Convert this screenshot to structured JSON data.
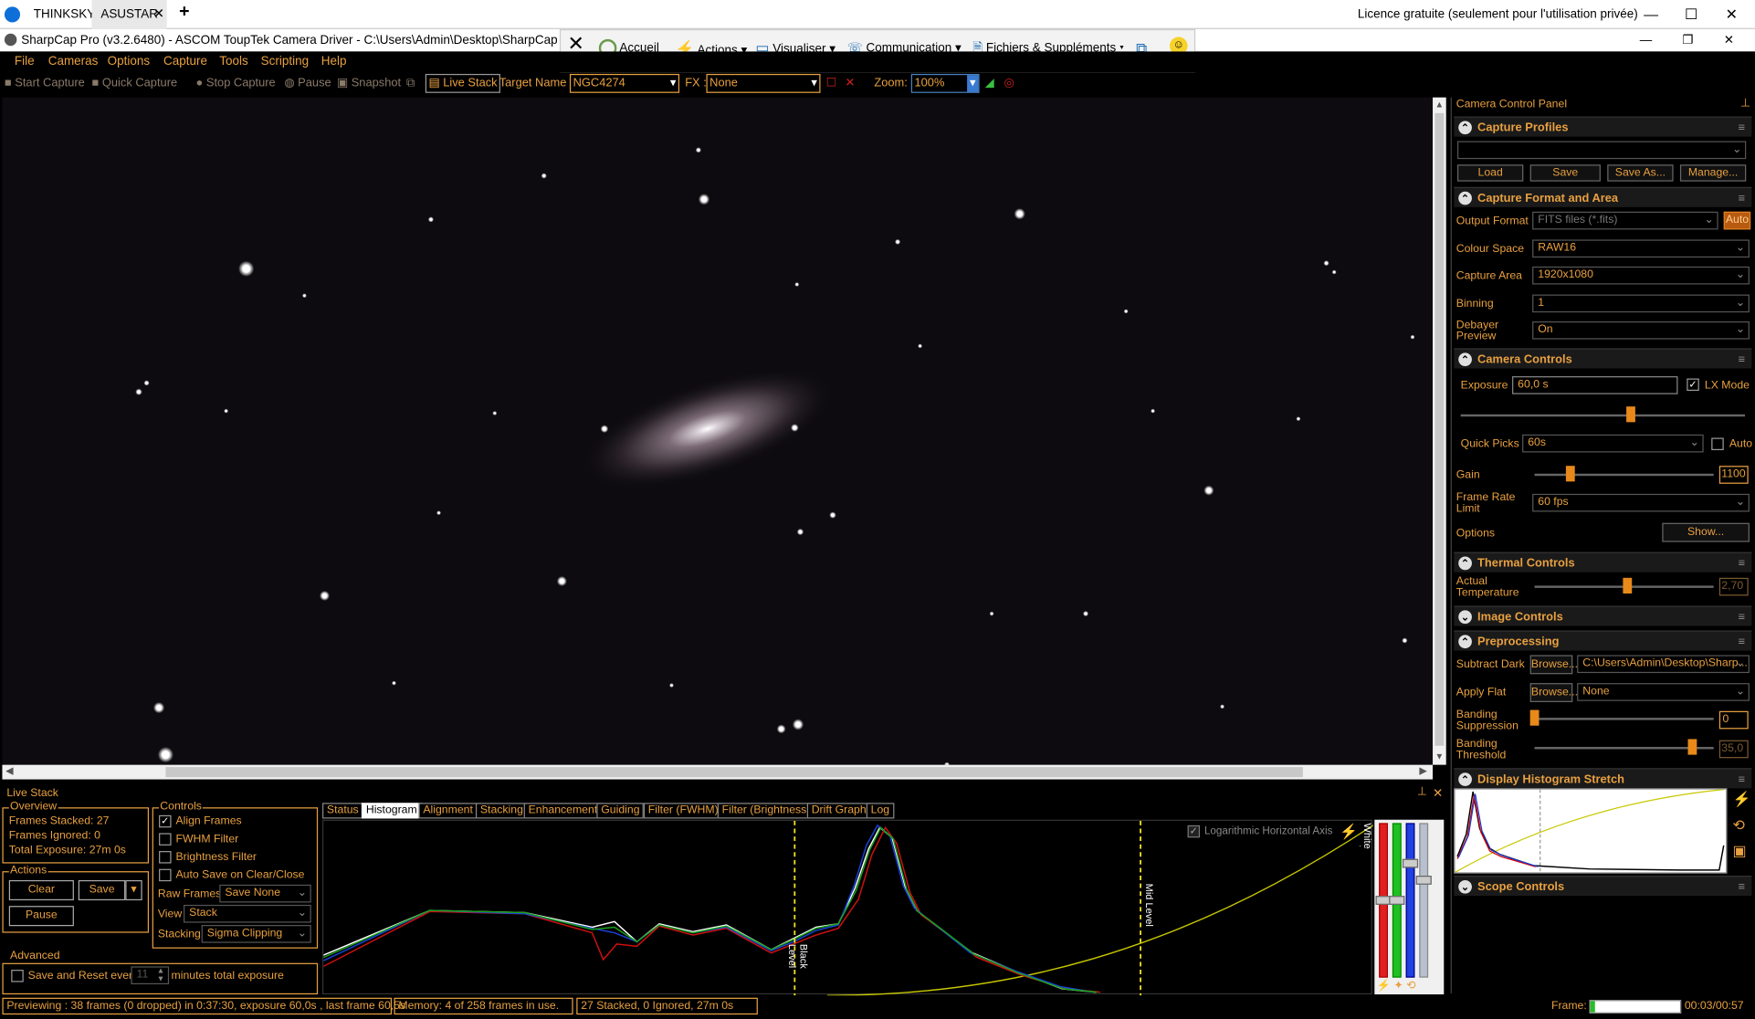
{
  "tv": {
    "tab1": "THINKSKY",
    "tab2": "ASUSTAR",
    "license": "Licence gratuite (seulement pour l'utilisation privée)",
    "toolbar": {
      "accueil": "Accueil",
      "actions": "Actions",
      "visualiser": "Visualiser",
      "communication": "Communication",
      "fichiers": "Fichiers & Suppléments"
    }
  },
  "app": {
    "title": "SharpCap Pro (v3.2.6480) - ASCOM ToupTek Camera Driver - C:\\Users\\Admin\\Desktop\\SharpCap Captures"
  },
  "menu": [
    "File",
    "Cameras",
    "Options",
    "Capture",
    "Tools",
    "Scripting",
    "Help"
  ],
  "toolbar": {
    "start_capture": "Start Capture",
    "quick_capture": "Quick Capture",
    "stop_capture": "Stop Capture",
    "pause": "Pause",
    "snapshot": "Snapshot",
    "live_stack": "Live Stack",
    "target_label": "Target Name :",
    "target_value": "NGC4274",
    "fx_label": "FX :",
    "fx_value": "None",
    "zoom_label": "Zoom:",
    "zoom_value": "100%"
  },
  "panel": {
    "title": "Camera Control Panel",
    "capture_profiles": {
      "title": "Capture Profiles",
      "load": "Load",
      "save": "Save",
      "save_as": "Save As...",
      "manage": "Manage..."
    },
    "format": {
      "title": "Capture Format and Area",
      "output_label": "Output Format",
      "output_value": "FITS files (*.fits)",
      "auto": "Auto",
      "colour_label": "Colour Space",
      "colour_value": "RAW16",
      "area_label": "Capture Area",
      "area_value": "1920x1080",
      "binning_label": "Binning",
      "binning_value": "1",
      "debayer_label1": "Debayer",
      "debayer_label2": "Preview",
      "debayer_value": "On"
    },
    "camera": {
      "title": "Camera Controls",
      "exposure_label": "Exposure",
      "exposure_value": "60,0 s",
      "lx_mode": "LX Mode",
      "exposure_level": 0.6,
      "quick_label": "Quick Picks",
      "quick_value": "60s",
      "auto": "Auto",
      "gain_label": "Gain",
      "gain_value": "1100",
      "gain_level": 0.2,
      "frl_label1": "Frame Rate",
      "frl_label2": "Limit",
      "frl_value": "60 fps",
      "options_label": "Options",
      "show": "Show..."
    },
    "thermal": {
      "title": "Thermal Controls",
      "temp_label1": "Actual",
      "temp_label2": "Temperature",
      "temp_value": "2,70",
      "temp_level": 0.52
    },
    "image_controls": "Image Controls",
    "preproc": {
      "title": "Preprocessing",
      "dark_label": "Subtract Dark",
      "browse": "Browse...",
      "dark_value": "C:\\Users\\Admin\\Desktop\\Sharp...",
      "flat_label": "Apply Flat",
      "flat_value": "None",
      "band_label1": "Banding",
      "band_label2": "Suppression",
      "band_value": "0",
      "band_level": 0.0,
      "bt_label1": "Banding",
      "bt_label2": "Threshold",
      "bt_value": "35,0",
      "bt_level": 0.88
    },
    "histogram_stretch": "Display Histogram Stretch",
    "scope": "Scope Controls"
  },
  "livestack": {
    "title": "Live Stack",
    "overview": "Overview",
    "frames_stacked": "Frames Stacked: 27",
    "frames_ignored": "Frames Ignored:   0",
    "total_exposure": "Total Exposure:   27m 0s",
    "actions": "Actions",
    "clear": "Clear",
    "save": "Save",
    "pause": "Pause",
    "controls": "Controls",
    "align": "Align Frames",
    "fwhm": "FWHM Filter",
    "brightness": "Brightness Filter",
    "autosave": "Auto Save on Clear/Close",
    "raw_label": "Raw Frames",
    "raw_value": "Save None",
    "view_label": "View",
    "view_value": "Stack",
    "stacking_label": "Stacking",
    "stacking_value": "Sigma Clipping",
    "advanced": "Advanced",
    "save_reset": "Save and Reset every",
    "minutes_value": "11",
    "minutes_suffix": "minutes total exposure",
    "tabs": [
      "Status",
      "Histogram",
      "Alignment",
      "Stacking",
      "Enhancement",
      "Guiding",
      "Filter (FWHM)",
      "Filter (Brightness)",
      "Drift Graph",
      "Log"
    ],
    "log_axis": "Logarithmic Horizontal Axis",
    "black_level": "Black Level",
    "mid_level": "Mid Level",
    "white_level": "White Level"
  },
  "status": {
    "previewing": "Previewing : 38 frames (0 dropped) in 0:37:30, exposure 60,0s , last frame 60,5s",
    "memory": "Memory: 4 of 258 frames in use.",
    "stacked": "27 Stacked, 0 Ignored, 27m 0s",
    "frame_label": "Frame:",
    "frame_time": "00:03/00:57"
  },
  "colors": {
    "accent": "#e8a040",
    "background": "#000000",
    "sky": "#0d0b0f"
  }
}
